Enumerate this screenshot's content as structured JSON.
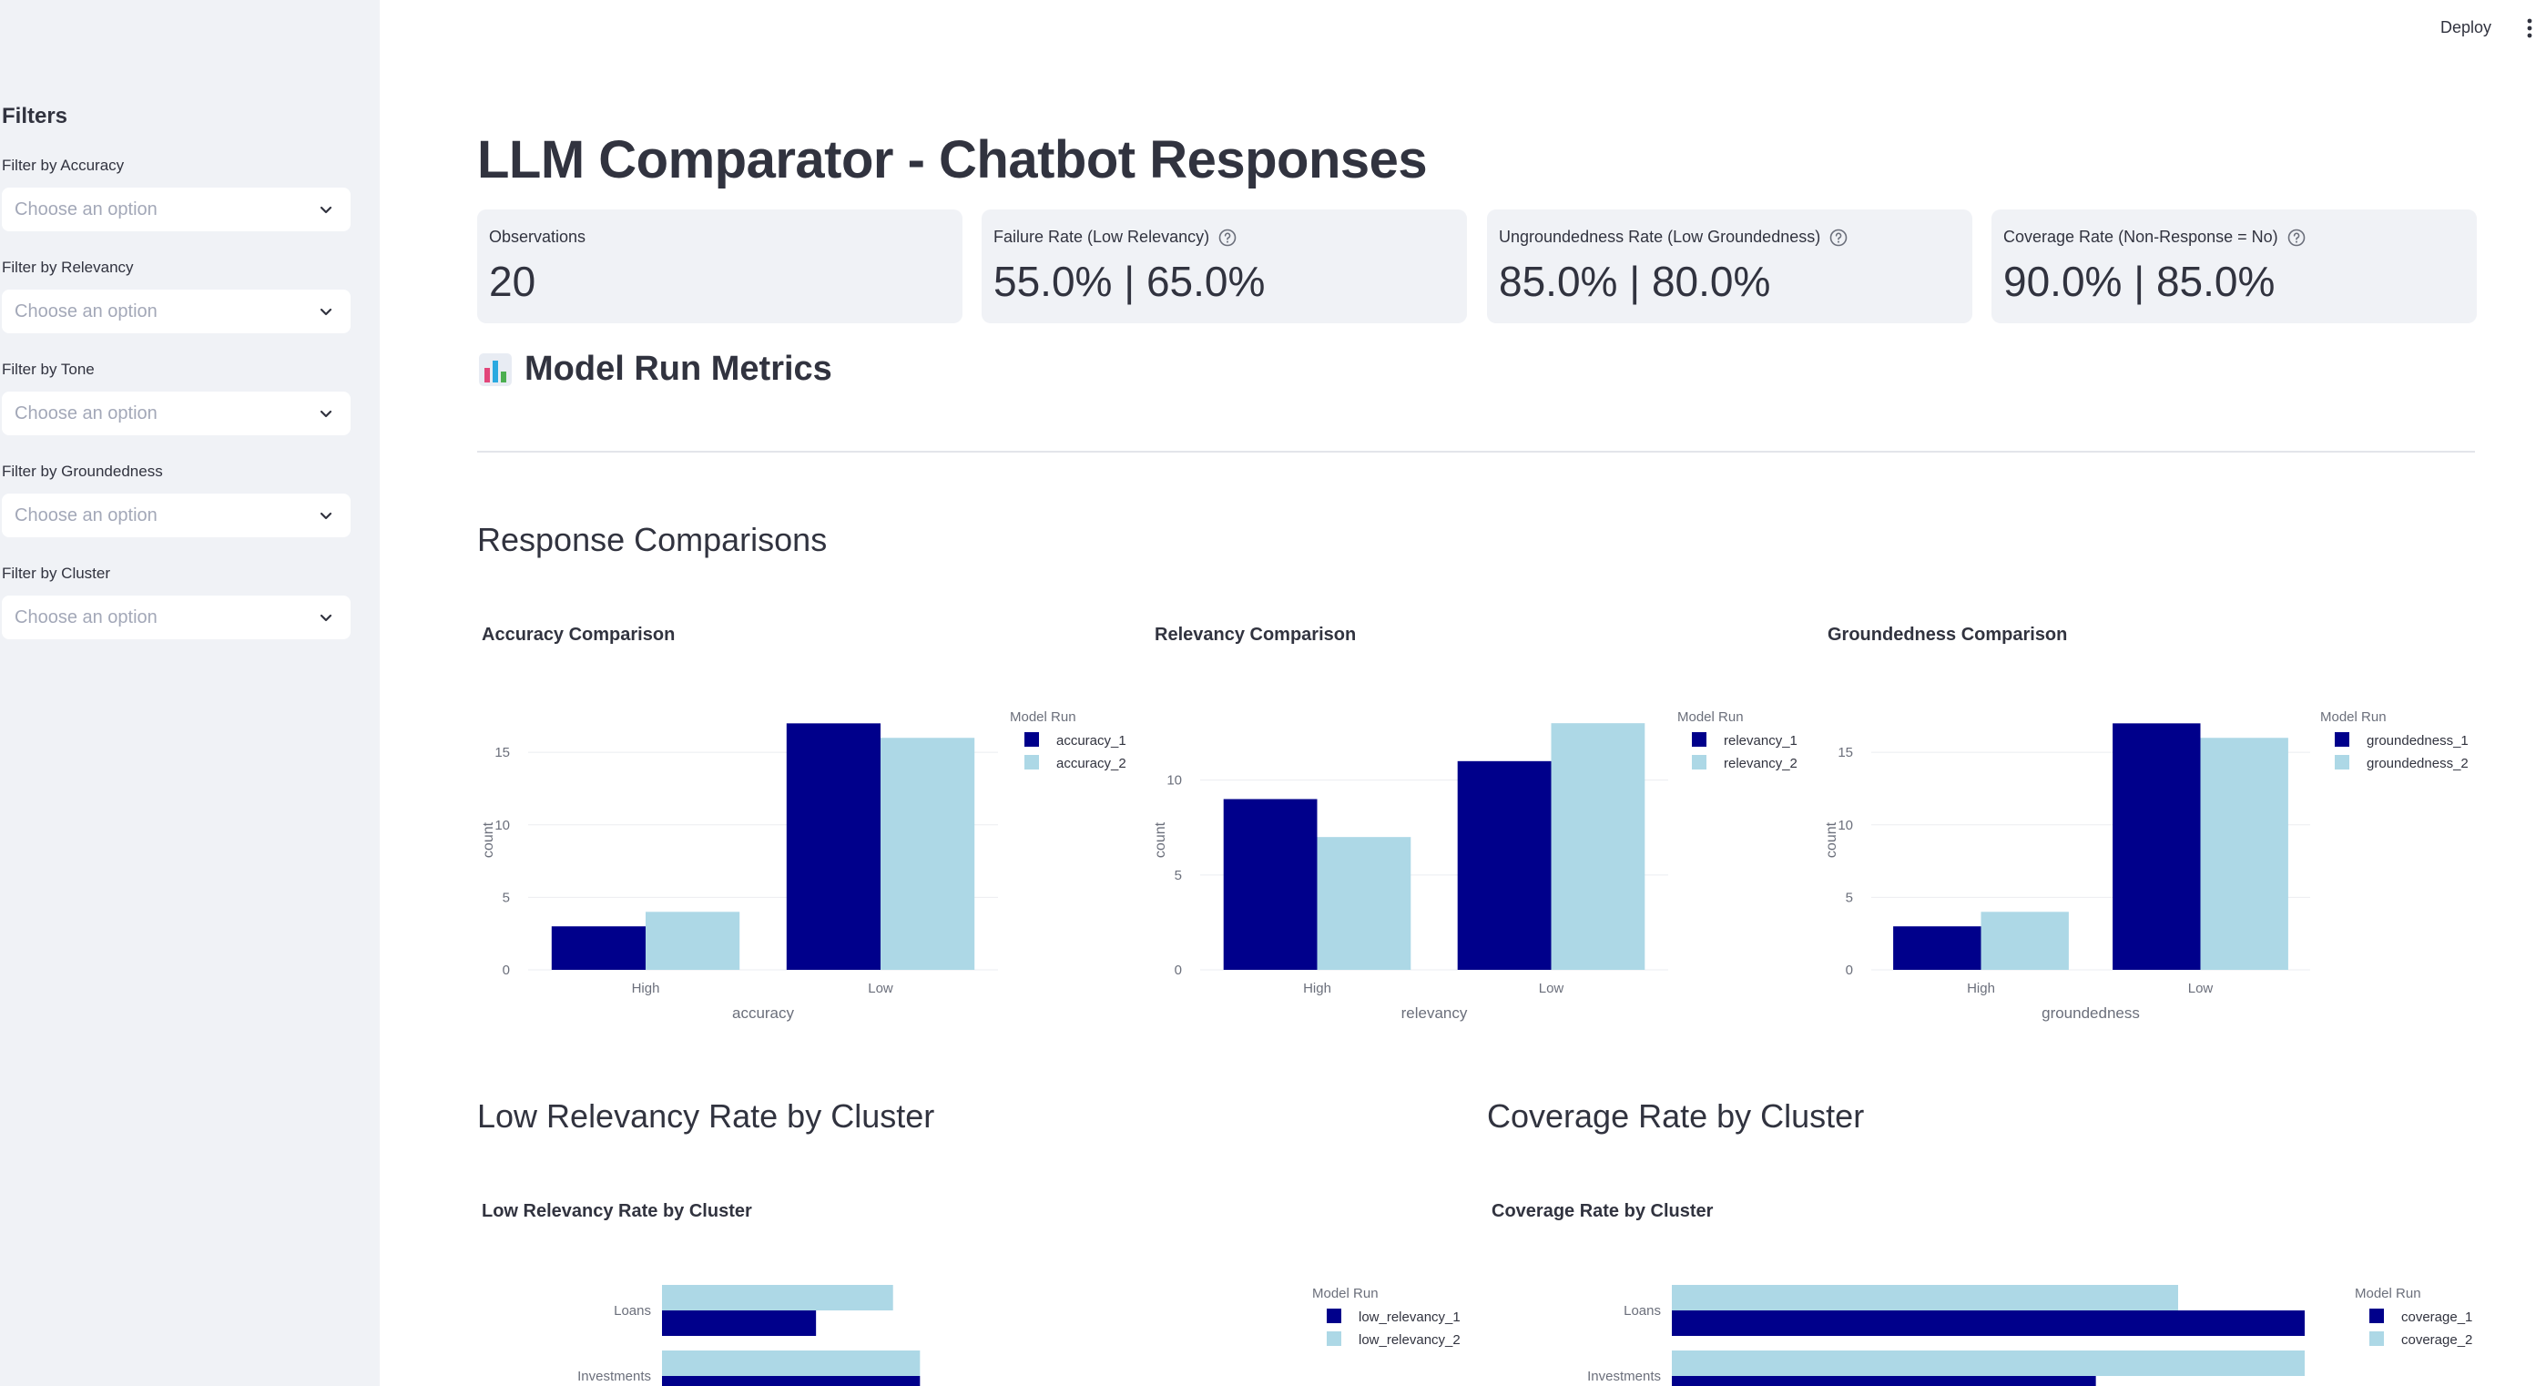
{
  "sidebar": {
    "title": "Filters",
    "filters": [
      {
        "label": "Filter by Accuracy",
        "placeholder": "Choose an option"
      },
      {
        "label": "Filter by Relevancy",
        "placeholder": "Choose an option"
      },
      {
        "label": "Filter by Tone",
        "placeholder": "Choose an option"
      },
      {
        "label": "Filter by Groundedness",
        "placeholder": "Choose an option"
      },
      {
        "label": "Filter by Cluster",
        "placeholder": "Choose an option"
      }
    ]
  },
  "header": {
    "deploy_label": "Deploy",
    "menu_icon": "kebab-menu-icon"
  },
  "main": {
    "title": "LLM Comparator - Chatbot Responses",
    "metrics": [
      {
        "label": "Observations",
        "value": "20",
        "help": false
      },
      {
        "label": "Failure Rate (Low Relevancy)",
        "value": "55.0% | 65.0%",
        "help": true
      },
      {
        "label": "Ungroundedness Rate (Low Groundedness)",
        "value": "85.0% | 80.0%",
        "help": true
      },
      {
        "label": "Coverage Rate (Non-Response = No)",
        "value": "90.0% | 85.0%",
        "help": true
      }
    ],
    "section_icon": "bar-chart-icon",
    "section_title": "Model Run Metrics",
    "response_comparisons_title": "Response Comparisons",
    "low_relevancy_section_title": "Low Relevancy Rate by Cluster",
    "coverage_section_title": "Coverage Rate by Cluster"
  },
  "colors": {
    "series_1": "#00008b",
    "series_2": "#add8e6",
    "sidebar_bg": "#f0f2f6"
  },
  "chart_data": [
    {
      "type": "bar",
      "title": "Accuracy Comparison",
      "categories": [
        "High",
        "Low"
      ],
      "series": [
        {
          "name": "accuracy_1",
          "values": [
            3,
            17
          ]
        },
        {
          "name": "accuracy_2",
          "values": [
            4,
            16
          ]
        }
      ],
      "xlabel": "accuracy",
      "ylabel": "count",
      "ylim": [
        0,
        17.9
      ],
      "yticks": [
        0,
        5,
        10,
        15
      ],
      "legend_title": "Model Run",
      "legend_position": "right",
      "grid": true
    },
    {
      "type": "bar",
      "title": "Relevancy Comparison",
      "categories": [
        "High",
        "Low"
      ],
      "series": [
        {
          "name": "relevancy_1",
          "values": [
            9,
            11
          ]
        },
        {
          "name": "relevancy_2",
          "values": [
            7,
            13
          ]
        }
      ],
      "xlabel": "relevancy",
      "ylabel": "count",
      "ylim": [
        0,
        13.68
      ],
      "yticks": [
        0,
        5,
        10
      ],
      "legend_title": "Model Run",
      "legend_position": "right",
      "grid": true
    },
    {
      "type": "bar",
      "title": "Groundedness Comparison",
      "categories": [
        "High",
        "Low"
      ],
      "series": [
        {
          "name": "groundedness_1",
          "values": [
            3,
            17
          ]
        },
        {
          "name": "groundedness_2",
          "values": [
            4,
            16
          ]
        }
      ],
      "xlabel": "groundedness",
      "ylabel": "count",
      "ylim": [
        0,
        17.9
      ],
      "yticks": [
        0,
        5,
        10,
        15
      ],
      "legend_title": "Model Run",
      "legend_position": "right",
      "grid": true
    },
    {
      "type": "bar",
      "orientation": "horizontal",
      "title": "Low Relevancy Rate by Cluster",
      "categories": [
        "Loans",
        "Investments"
      ],
      "series": [
        {
          "name": "low_relevancy_1",
          "values": [
            0.4,
            0.67
          ]
        },
        {
          "name": "low_relevancy_2",
          "values": [
            0.6,
            0.67
          ]
        }
      ],
      "xlim": [
        0,
        1.05
      ],
      "legend_title": "Model Run",
      "legend_position": "right"
    },
    {
      "type": "bar",
      "orientation": "horizontal",
      "title": "Coverage Rate by Cluster",
      "categories": [
        "Loans",
        "Investments"
      ],
      "series": [
        {
          "name": "coverage_1",
          "values": [
            1.0,
            0.67
          ]
        },
        {
          "name": "coverage_2",
          "values": [
            0.8,
            1.0
          ]
        }
      ],
      "xlim": [
        0,
        1.0
      ],
      "legend_title": "Model Run",
      "legend_position": "right"
    }
  ]
}
